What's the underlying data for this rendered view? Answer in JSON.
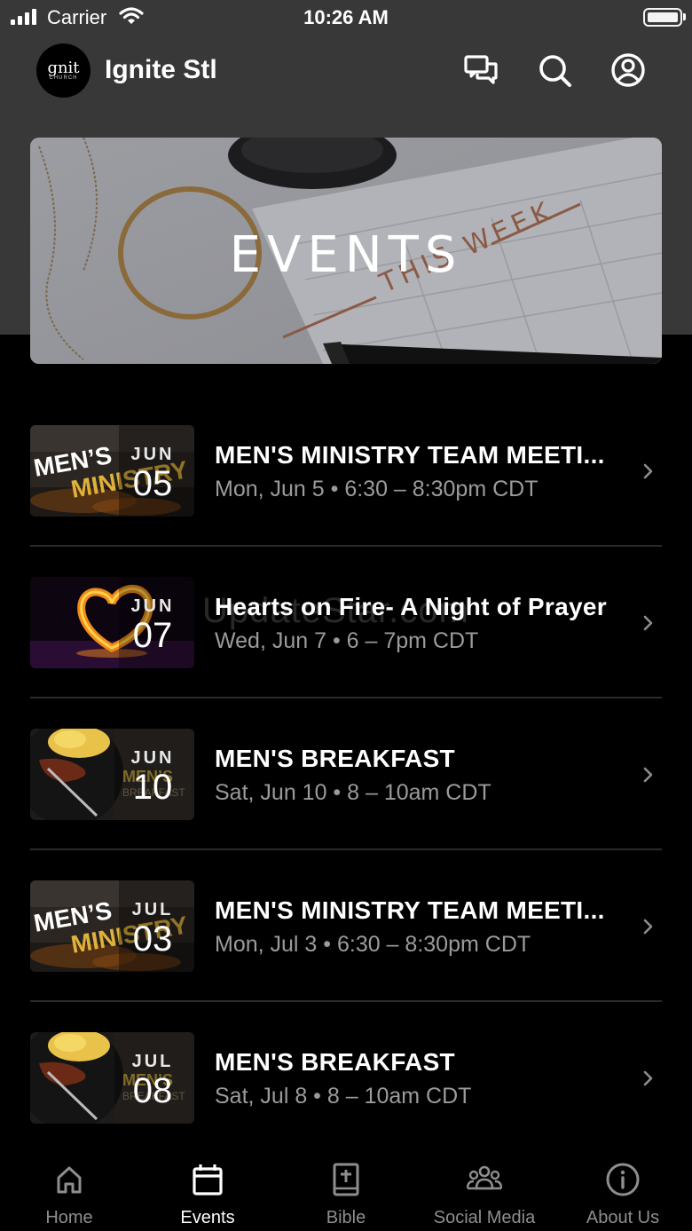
{
  "status_bar": {
    "carrier": "Carrier",
    "time": "10:26 AM"
  },
  "header": {
    "logo_text": "gnit",
    "logo_subtext": "CHURCH",
    "title": "Ignite Stl",
    "icons": [
      "chat-icon",
      "search-icon",
      "profile-icon"
    ]
  },
  "hero": {
    "title": "EVENTS"
  },
  "events": [
    {
      "month": "JUN",
      "day": "05",
      "title": "MEN'S MINISTRY TEAM MEETI...",
      "subtitle": "Mon, Jun 5 • 6:30 – 8:30pm CDT",
      "thumb": "ministry"
    },
    {
      "month": "JUN",
      "day": "07",
      "title": "Hearts on Fire- A Night of Prayer",
      "subtitle": "Wed, Jun 7 • 6 – 7pm CDT",
      "thumb": "heart"
    },
    {
      "month": "JUN",
      "day": "10",
      "title": "MEN'S BREAKFAST",
      "subtitle": "Sat, Jun 10 • 8 – 10am CDT",
      "thumb": "breakfast"
    },
    {
      "month": "JUL",
      "day": "03",
      "title": "MEN'S MINISTRY TEAM MEETI...",
      "subtitle": "Mon, Jul 3 • 6:30 – 8:30pm CDT",
      "thumb": "ministry"
    },
    {
      "month": "JUL",
      "day": "08",
      "title": "MEN'S BREAKFAST",
      "subtitle": "Sat, Jul 8 • 8 – 10am CDT",
      "thumb": "breakfast"
    }
  ],
  "watermark": "UpdateStar.com",
  "tabs": [
    {
      "label": "Home",
      "icon": "home-icon",
      "active": false
    },
    {
      "label": "Events",
      "icon": "calendar-icon",
      "active": true
    },
    {
      "label": "Bible",
      "icon": "bible-icon",
      "active": false
    },
    {
      "label": "Social Media",
      "icon": "people-icon",
      "active": false
    },
    {
      "label": "About Us",
      "icon": "info-icon",
      "active": false
    }
  ],
  "colors": {
    "header_bg": "#383838",
    "background": "#000000",
    "subtitle": "#9b9b9b",
    "tab_inactive": "#8e8e8e"
  }
}
